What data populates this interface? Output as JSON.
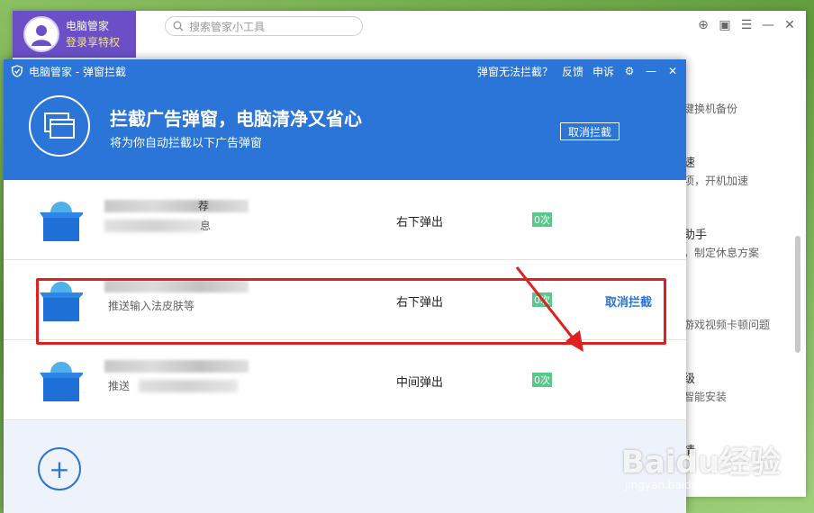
{
  "bg_app": {
    "profile_name": "电脑管家",
    "profile_vip": "登录享特权",
    "search_placeholder": "搜索管家小工具",
    "list": [
      {
        "t1": "",
        "t2": "键换机备份"
      },
      {
        "t1": "速",
        "t2": "项，开机加速"
      },
      {
        "t1": "助手",
        "t2": "，制定休息方案"
      },
      {
        "t1": "",
        "t2": "游戏视频卡顿问题"
      },
      {
        "t1": "级",
        "t2": "智能安装"
      },
      {
        "t1": "情",
        "t2": ""
      }
    ]
  },
  "popup": {
    "title": "电脑管家 - 弹窗拦截",
    "links": {
      "cant_block": "弹窗无法拦截？",
      "feedback": "反馈",
      "appeal": "申诉"
    },
    "header_title": "拦截广告弹窗，电脑清净又省心",
    "header_sub": "将为你自动拦截以下广告弹窗",
    "header_cancel": "取消拦截",
    "rows": [
      {
        "name_tail": "荐",
        "desc": "息",
        "pos": "右下弹出",
        "count": "0次",
        "cancel": ""
      },
      {
        "name_tail": "",
        "desc": "推送输入法皮肤等",
        "pos": "右下弹出",
        "count": "0次",
        "cancel": "取消拦截"
      },
      {
        "name_tail": "",
        "desc": "推送",
        "pos": "中间弹出",
        "count": "0次",
        "cancel": ""
      }
    ],
    "add_symbol": "+"
  },
  "watermark": {
    "brand": "Baidu经验",
    "url": "jingyan.baidu.com"
  },
  "colors": {
    "accent": "#2b74d8",
    "highlight": "#e02020",
    "count_badge": "#58c98b"
  }
}
